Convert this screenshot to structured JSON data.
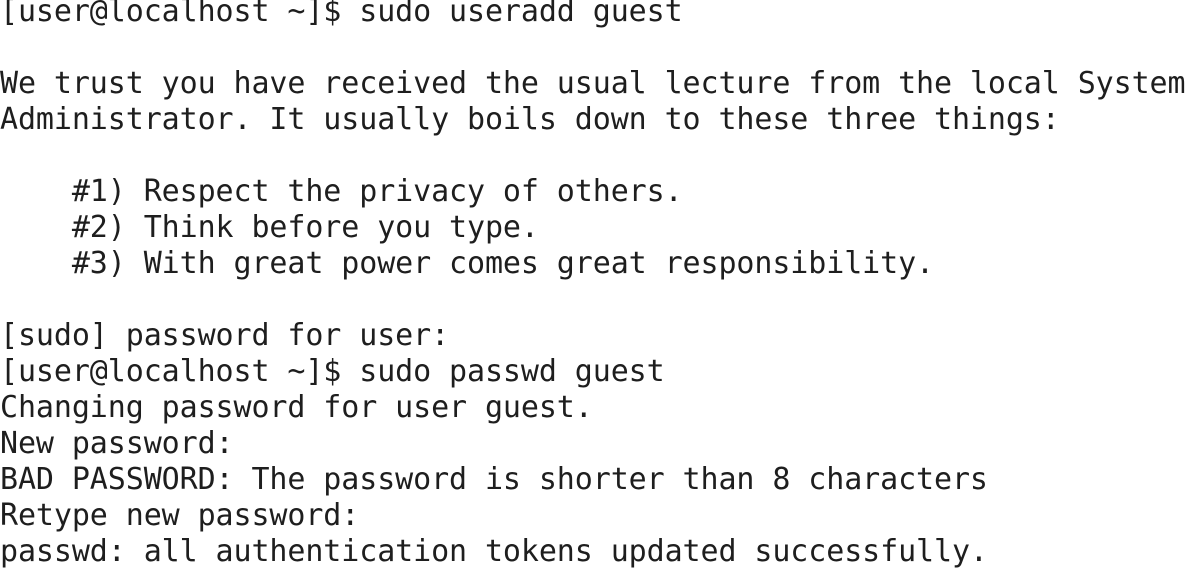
{
  "terminal": {
    "lines": [
      "[user@localhost ~]$ sudo useradd guest",
      "",
      "We trust you have received the usual lecture from the local System",
      "Administrator. It usually boils down to these three things:",
      "",
      "    #1) Respect the privacy of others.",
      "    #2) Think before you type.",
      "    #3) With great power comes great responsibility.",
      "",
      "[sudo] password for user:",
      "[user@localhost ~]$ sudo passwd guest",
      "Changing password for user guest.",
      "New password:",
      "BAD PASSWORD: The password is shorter than 8 characters",
      "Retype new password:",
      "passwd: all authentication tokens updated successfully."
    ]
  }
}
